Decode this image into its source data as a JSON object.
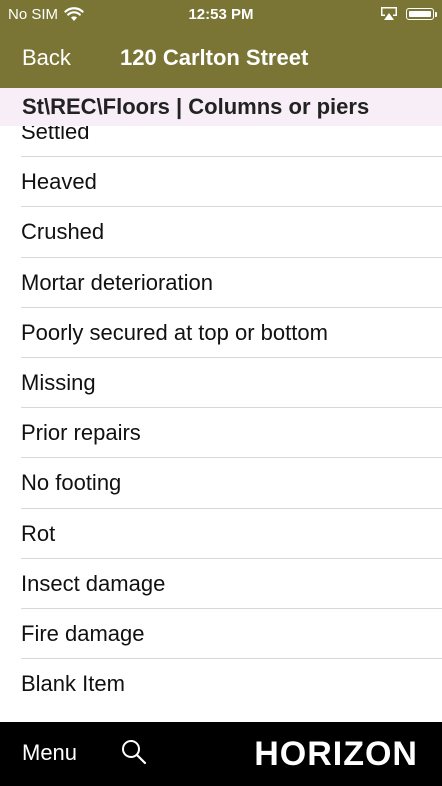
{
  "status_bar": {
    "carrier": "No SIM",
    "time": "12:53 PM"
  },
  "nav": {
    "back_label": "Back",
    "title": "120 Carlton Street"
  },
  "section": {
    "header": "St\\REC\\Floors | Columns or piers"
  },
  "list_items": [
    "Settled",
    "Heaved",
    "Crushed",
    "Mortar deterioration",
    "Poorly secured at top or bottom",
    "Missing",
    "Prior repairs",
    "No footing",
    "Rot",
    "Insect damage",
    "Fire damage",
    "Blank Item"
  ],
  "bottom_bar": {
    "menu_label": "Menu",
    "brand": "HORIZON"
  },
  "colors": {
    "nav": "#7b7535",
    "section_header": "#f7eef7",
    "bottom": "#000000"
  },
  "icons": [
    "wifi-icon",
    "airplay-icon",
    "battery-icon",
    "search-icon"
  ]
}
